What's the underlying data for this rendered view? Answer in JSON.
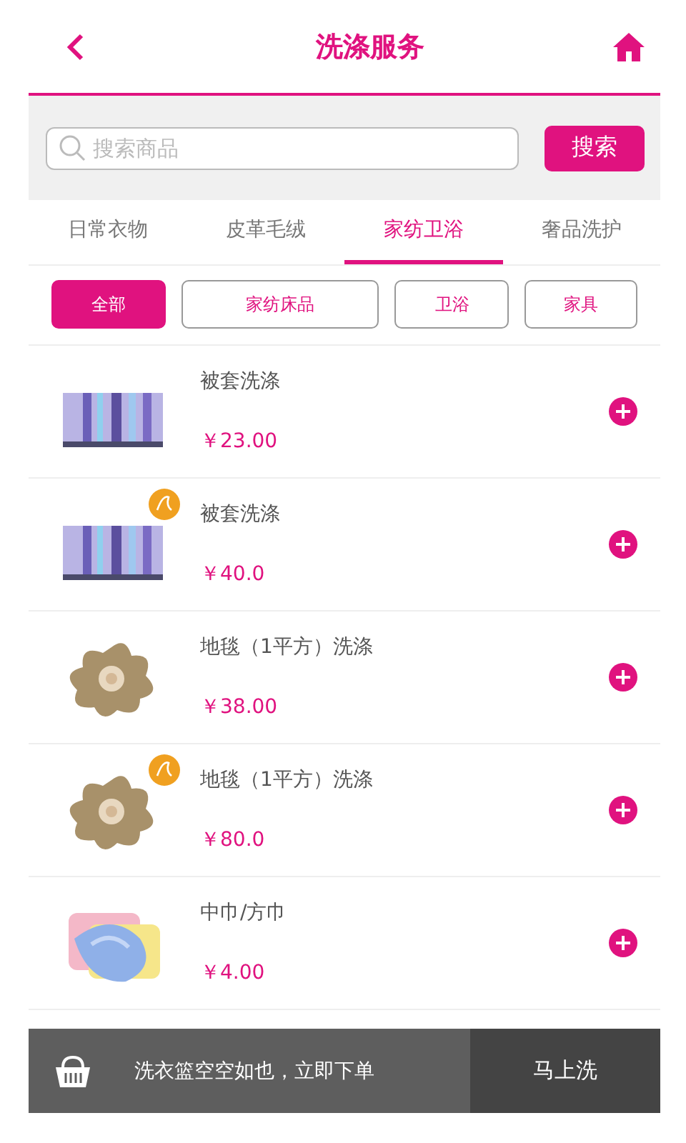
{
  "header": {
    "title": "洗涤服务"
  },
  "search": {
    "placeholder": "搜索商品",
    "button": "搜索"
  },
  "tabs": [
    {
      "label": "日常衣物",
      "selected": false
    },
    {
      "label": "皮革毛绒",
      "selected": false
    },
    {
      "label": "家纺卫浴",
      "selected": true
    },
    {
      "label": "奢品洗护",
      "selected": false
    }
  ],
  "filters": [
    {
      "label": "全部",
      "selected": true
    },
    {
      "label": "家纺床品",
      "selected": false
    },
    {
      "label": "卫浴",
      "selected": false
    },
    {
      "label": "家具",
      "selected": false
    }
  ],
  "products": [
    {
      "name": "被套洗涤",
      "price": "￥23.00",
      "kind": "picture",
      "badge": false
    },
    {
      "name": "被套洗涤",
      "price": "￥40.0",
      "kind": "picture",
      "badge": true
    },
    {
      "name": "地毯（1平方）洗涤",
      "price": "￥38.00",
      "kind": "picture",
      "badge": false
    },
    {
      "name": "地毯（1平方）洗涤",
      "price": "￥80.0",
      "kind": "picture",
      "badge": true
    },
    {
      "name": "中巾/方巾",
      "price": "￥4.00",
      "kind": "picture",
      "badge": false
    }
  ],
  "cart_bar": {
    "message": "洗衣篮空空如也，立即下单",
    "button": "马上洗"
  }
}
